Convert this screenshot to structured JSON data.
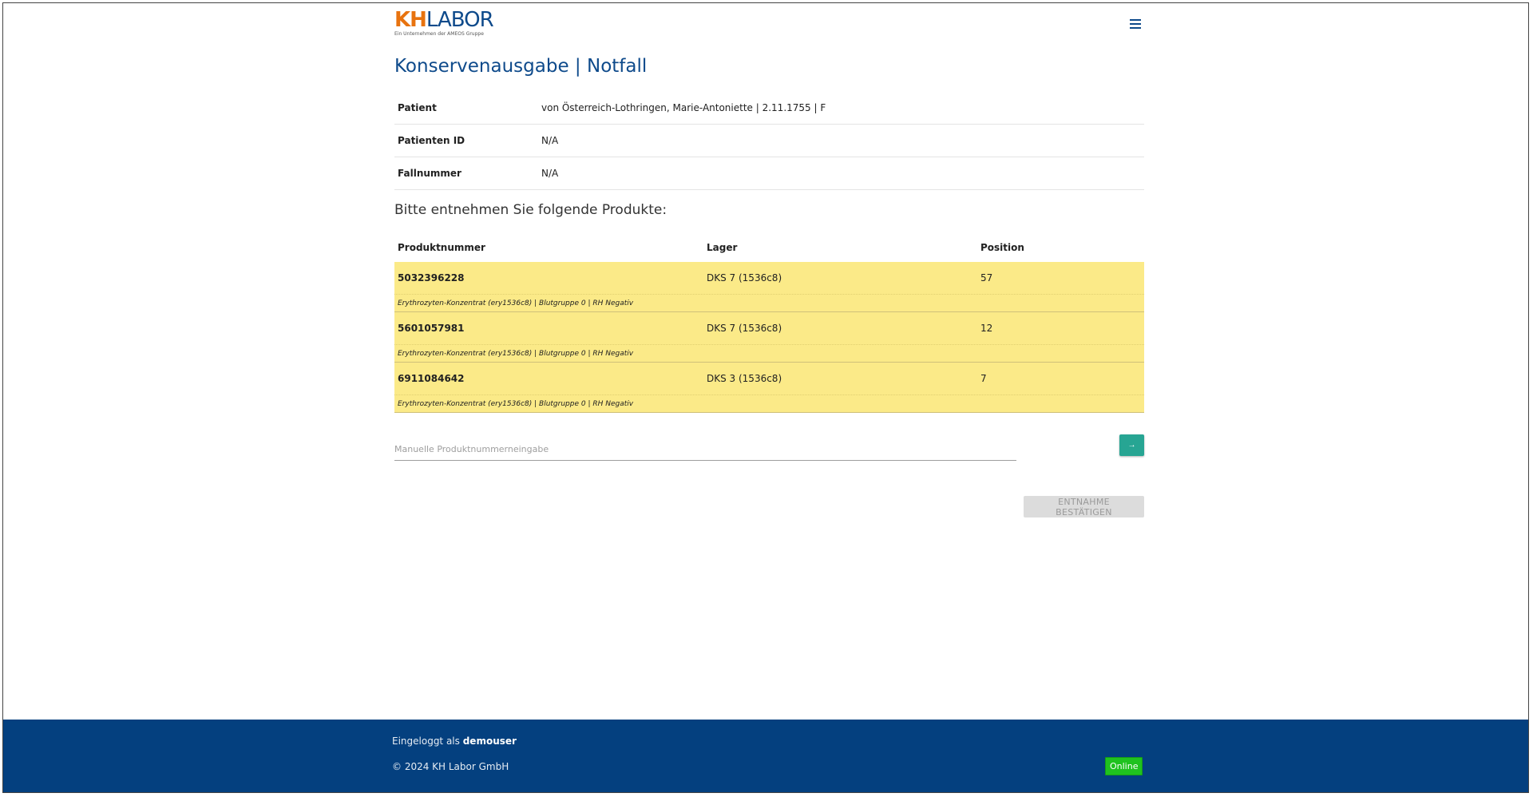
{
  "header": {
    "logo_kh": "KH",
    "logo_labor": "LABOR",
    "logo_sub": "Ein Unternehmen der AMEOS Gruppe"
  },
  "page": {
    "title": "Konservenausgabe | Notfall",
    "instruction": "Bitte entnehmen Sie folgende Produkte:"
  },
  "patient_info": [
    {
      "label": "Patient",
      "value": "von Österreich-Lothringen, Marie-Antoniette | 2.11.1755 | F"
    },
    {
      "label": "Patienten ID",
      "value": "N/A"
    },
    {
      "label": "Fallnummer",
      "value": "N/A"
    }
  ],
  "products": {
    "headers": {
      "number": "Produktnummer",
      "storage": "Lager",
      "position": "Position"
    },
    "rows": [
      {
        "number": "5032396228",
        "storage": "DKS 7 (1536c8)",
        "position": "57",
        "description": "Erythrozyten-Konzentrat (ery1536c8) | Blutgruppe 0 | RH Negativ"
      },
      {
        "number": "5601057981",
        "storage": "DKS 7 (1536c8)",
        "position": "12",
        "description": "Erythrozyten-Konzentrat (ery1536c8) | Blutgruppe 0 | RH Negativ"
      },
      {
        "number": "6911084642",
        "storage": "DKS 3 (1536c8)",
        "position": "7",
        "description": "Erythrozyten-Konzentrat (ery1536c8) | Blutgruppe 0 | RH Negativ"
      }
    ]
  },
  "manual_entry": {
    "placeholder": "Manuelle Produktnummerneingabe",
    "value": "",
    "submit_icon": "→"
  },
  "confirm_button": "ENTNAHME BESTÄTIGEN",
  "footer": {
    "login_prefix": "Eingeloggt als",
    "username": "demouser",
    "copyright": "© 2024 KH Labor GmbH",
    "status": "Online"
  },
  "colors": {
    "brand_blue": "#0e4a8b",
    "brand_orange": "#e8730f",
    "row_highlight": "#fbea88",
    "accent_teal": "#27a593",
    "footer_bg": "#04407f",
    "online_green": "#1fc21f"
  }
}
